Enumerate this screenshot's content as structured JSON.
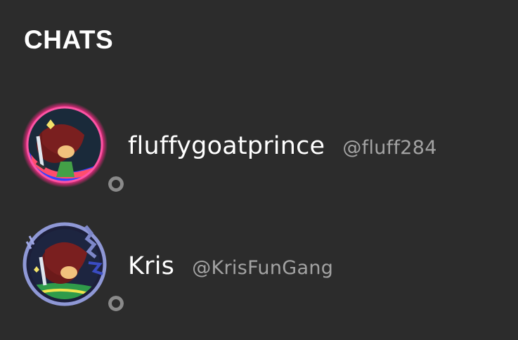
{
  "section": {
    "title": "CHATS"
  },
  "chats": [
    {
      "display_name": "fluffygoatprince",
      "handle": "@fluff284",
      "status": "offline",
      "avatar_icon": "character-avatar-icon",
      "ring_colors": [
        "#ff2a8a",
        "#3a4bff",
        "#ff3366"
      ]
    },
    {
      "display_name": "Kris",
      "handle": "@KrisFunGang",
      "status": "offline",
      "avatar_icon": "character-avatar-icon",
      "ring_colors": [
        "#7d87c9",
        "#2e3a8c"
      ]
    }
  ],
  "colors": {
    "background": "#2c2c2c",
    "text_primary": "#ffffff",
    "text_secondary": "#a3a3a3",
    "status_offline": "#8a8a8a"
  }
}
